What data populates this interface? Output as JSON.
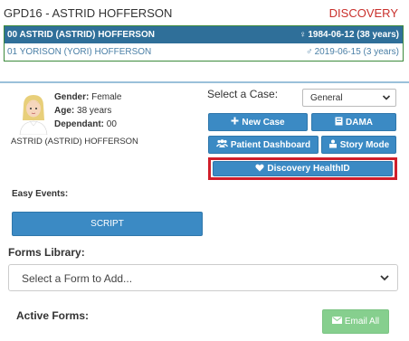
{
  "header": {
    "title": "GPD16 - ASTRID HOFFERSON",
    "tag": "DISCOVERY",
    "tag_color": "#c9302c"
  },
  "family": [
    {
      "name": "00 ASTRID (ASTRID) HOFFERSON",
      "dob": "1984-06-12 (38 years)",
      "icon": "female-icon",
      "active": true
    },
    {
      "name": "01 YORISON (YORI) HOFFERSON",
      "dob": "2019-06-15 (3 years)",
      "icon": "male-icon",
      "active": false
    }
  ],
  "patient": {
    "gender_label": "Gender:",
    "gender": "Female",
    "age_label": "Age:",
    "age": "38 years",
    "dependant_label": "Dependant:",
    "dependant": "00",
    "full_name": "ASTRID (ASTRID) HOFFERSON"
  },
  "case": {
    "label": "Select a Case:",
    "value": "General"
  },
  "buttons": {
    "new_case": "New Case",
    "dama": "DAMA",
    "dashboard": "Patient Dashboard",
    "story": "Story Mode",
    "healthid": "Discovery HealthID",
    "script": "SCRIPT",
    "email_all": "Email All"
  },
  "easy_events": {
    "label": "Easy Events:"
  },
  "forms_library": {
    "label": "Forms Library:",
    "placeholder": "Select a Form to Add..."
  },
  "active_forms": {
    "label": "Active Forms:"
  },
  "colors": {
    "primary": "#3b8ac4",
    "active_row": "#2f6f99",
    "highlight": "#d01e2a",
    "success": "#86cf8e"
  }
}
